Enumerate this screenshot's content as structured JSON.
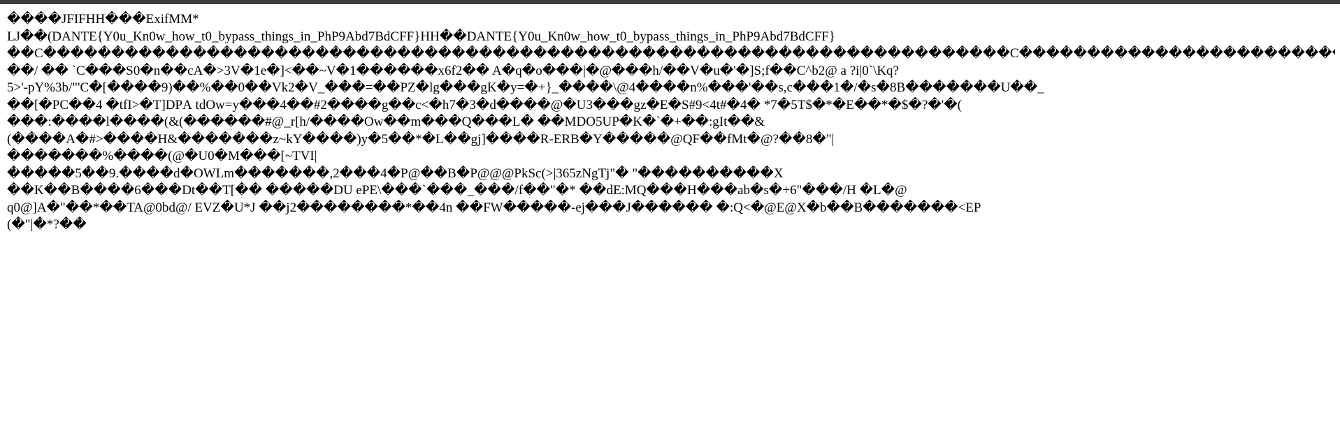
{
  "browser": {
    "topbar_color": "#3c3c3c",
    "background": "#ffffff",
    "text_color": "#000000"
  },
  "raw_text_lines": [
    "����\u0010JFIF\u0001\u0001\u0001HH���ExifMM*\u0000\u0000\u0000",
    "\u0002LJ\u0001\u0001\u0001\u0001\u0001�\u0001\u0001\u0001\u0001\u0001�\u0001(\u0001\u0001\u0001\u0001\u0001\u0001\u0001\u0001\u0001DANTE{Y0u_Kn0w_how_t0_bypass_things_in_PhP9Abd7BdCFF}H\u0001H\u0001��\u0001DANTE{Y0u_Kn0w_how_t0_bypass_things_in_PhP9Abd7BdCFF}",
    "��C�����������������������������������������������������������������������C\u0001���������������������������������",
    "��/ �� `C���S0�n��cA�>\u00013\u0001V�1e�\u0001]<�\u0001�~V�1�\u0001�����\u0001x6f2�� A�q�\u0001\u0001\u0001\u0001\u0001o���|�@���h/��V�u\u0001�'�]\u0001S;\u0001f�\u0001�\u0001C\u0001\u0001^\u0001b2\u0001\u0001\u0001@\u0001 \u0001\u0001\u0001a\u0001 \u0001\u0001\u0001\u0001\u0001?i\u0001\u0001\u0001|0\u0001`\u0001\u0001\\\u0001K\u0001q?",
    "5>\u0001'-\u0001p\u0001Y\u0001%\u00013\u0001b/\u0001\"\u0001\u0001\u0001'\u0001C�[\u0001����9)��%��\u00010\u0001��Vk2�\u0001V_���=��PZ�lg���gK�y\u0001=�+}_���\u0001�\\@\u00014\u0001����n%���'\u0001��s,c��\u0001�1�/�s�\u00018B�������U��_\u0001",
    "\u0001��[�PC��4 �tfI>�T]DP\u0001A\u0001 t\u0001dOw=\u0001y���4��#2����g��c<�h7�3�d����\u0001\u0001@\u0001�U\u00013���gz�E�S#9<4t#\u0001\u0001\u0001�\u0001\u00014\u0001� \u0001*7�5\u0001T$�*�\u0001E��*�$�?�\u0001'�(\u0001",
    "���:����l����\u0001(&(�����\u0001�#\u0001@_r[h\u0001\u0001/\u0001����Ow��\u0001m���Q���L�\u0001 ��M\u0001D\u0001O5U\u0001\u0001\u0001P\u0001�K�`�+\u0001�\u0001�:gIt��&",
    "(�\u0001���A�#>�\u0001\u0001\u0001\u0001���H\u0001&�������z~kY\u0001�\u0001\u0001\u0001���\u0001)y�5��*�L\u0001��gj]����\u0001R-ERB�\u0001Y�����@Q\u0001F��fMt�@?��8�\u0001\"\u0001|",
    "�������%\u0001\u0001����(@\u0001\u0001\u0001�\u0001U0\u0001�M���[~\u0001\u0001\u0001\u0001\u0001T\u0001VI|",
    "�����5��9.����d�OWLm�������,\u00012���4�P\u0001@\u0001\u0001\u0001�\u0001�B\u0001�P\u0001\u0001@\u0001\u0001@\u0001@\u0001\u0001\u0001PkS\u0001c(\u0001\u0001>|3\u0001\u0001\u0001\u0001\u000165zN\u0001g\u0001\u0001\u0001Tj\u0001\"� \"��\u0001���\u0001���\u0001�\u0001�X\u0001\u0001\u0001",
    "\u0001\u0001\u0001��K��B����6���D\u0001t��T[�� �����\u0001DU eP\u0001\u0001\u0001\u0001\u0001E\\���`\u0001���_\u0001��\u0001�/f\u0001��\"�* ��dE\u0001:MQ���H���ab�s\u0001�+6\"���\u0001\u0001/H �L�@\u0001",
    "\u0001q0@]A�\"��*\u0001��\u0001TA@0b\u0001\u0001\u0001d@\u0001\u0001\u0001/\u0001 \u0001\u0001\u0001EVZ�U*J �\u0001�j2������\u0001\u0001\u0001��*\u0001��\u0001\u00014\u0001\u0001n �\u0001�FW���\u0001��-ej\u0001�\u0001�\u0001�\u0001J�����\u0001� �:Q<�@E@\u0001X�b��B�\u0001������<\u0001\u0001\u0001\u0001E\u0001P\u0001",
    "\u0001(\u0001�\"|�*?��"
  ]
}
